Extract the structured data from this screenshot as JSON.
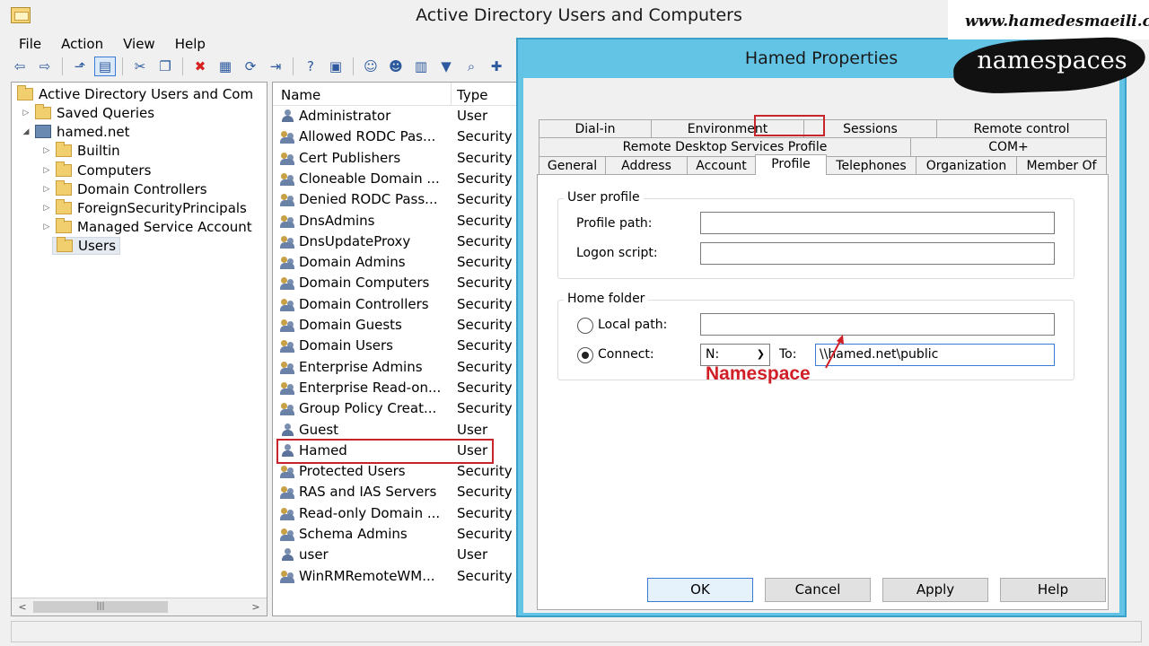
{
  "window": {
    "title": "Active Directory Users and Computers"
  },
  "menu": [
    "File",
    "Action",
    "View",
    "Help"
  ],
  "toolbar": {
    "icons": [
      "back-icon",
      "forward-icon",
      "up-folder-icon",
      "show-console-tree-icon",
      "cut-icon",
      "copy-icon",
      "delete-icon",
      "properties-icon",
      "refresh-icon",
      "export-icon",
      "help-icon",
      "action-pane-icon",
      "new-user-icon",
      "new-group-icon",
      "new-ou-icon",
      "filter-icon",
      "find-icon",
      "add-to-group-icon"
    ]
  },
  "tree": {
    "root": "Active Directory Users and Com",
    "items": [
      {
        "label": "Saved Queries"
      },
      {
        "label": "hamed.net"
      },
      {
        "label": "Builtin"
      },
      {
        "label": "Computers"
      },
      {
        "label": "Domain Controllers"
      },
      {
        "label": "ForeignSecurityPrincipals"
      },
      {
        "label": "Managed Service Account"
      },
      {
        "label": "Users"
      }
    ]
  },
  "list": {
    "columns": {
      "name": "Name",
      "type": "Type"
    },
    "rows": [
      {
        "name": "Administrator",
        "type": "User"
      },
      {
        "name": "Allowed RODC Pas...",
        "type": "Security"
      },
      {
        "name": "Cert Publishers",
        "type": "Security"
      },
      {
        "name": "Cloneable Domain ...",
        "type": "Security"
      },
      {
        "name": "Denied RODC Pass...",
        "type": "Security"
      },
      {
        "name": "DnsAdmins",
        "type": "Security"
      },
      {
        "name": "DnsUpdateProxy",
        "type": "Security"
      },
      {
        "name": "Domain Admins",
        "type": "Security"
      },
      {
        "name": "Domain Computers",
        "type": "Security"
      },
      {
        "name": "Domain Controllers",
        "type": "Security"
      },
      {
        "name": "Domain Guests",
        "type": "Security"
      },
      {
        "name": "Domain Users",
        "type": "Security"
      },
      {
        "name": "Enterprise Admins",
        "type": "Security"
      },
      {
        "name": "Enterprise Read-on...",
        "type": "Security"
      },
      {
        "name": "Group Policy Creat...",
        "type": "Security"
      },
      {
        "name": "Guest",
        "type": "User"
      },
      {
        "name": "Hamed",
        "type": "User"
      },
      {
        "name": "Protected Users",
        "type": "Security"
      },
      {
        "name": "RAS and IAS Servers",
        "type": "Security"
      },
      {
        "name": "Read-only Domain ...",
        "type": "Security"
      },
      {
        "name": "Schema Admins",
        "type": "Security"
      },
      {
        "name": "user",
        "type": "User"
      },
      {
        "name": "WinRMRemoteWM...",
        "type": "Security"
      }
    ]
  },
  "dialog": {
    "title": "Hamed Properties",
    "tabs_row1": [
      "Dial-in",
      "Environment",
      "Sessions",
      "Remote control"
    ],
    "tabs_row2": [
      "Remote Desktop Services Profile",
      "COM+"
    ],
    "tabs_row3": [
      "General",
      "Address",
      "Account",
      "Profile",
      "Telephones",
      "Organization",
      "Member Of"
    ],
    "active_tab": "Profile",
    "user_profile": {
      "group_label": "User profile",
      "profile_path_label": "Profile path:",
      "profile_path_value": "",
      "logon_script_label": "Logon script:",
      "logon_script_value": ""
    },
    "home_folder": {
      "group_label": "Home folder",
      "local_path_label": "Local path:",
      "local_path_value": "",
      "connect_label": "Connect:",
      "drive": "N:",
      "to_label": "To:",
      "to_value": "\\\\hamed.net\\public",
      "selected": "connect"
    },
    "buttons": {
      "ok": "OK",
      "cancel": "Cancel",
      "apply": "Apply",
      "help": "Help"
    }
  },
  "annotation": {
    "text": "Namespace",
    "color": "#d01f26"
  },
  "watermark": {
    "url": "www.hamedesmaeili.com",
    "badge": "namespaces"
  },
  "colors": {
    "dialog_frame": "#64c4e6",
    "highlight_red": "#c8242b"
  }
}
